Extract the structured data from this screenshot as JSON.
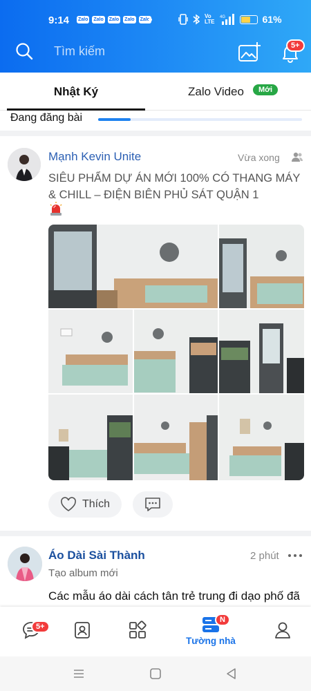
{
  "status_bar": {
    "time": "9:14",
    "notification_apps": [
      "Zalo",
      "Zalo",
      "Zalo",
      "Zalo",
      "Zalo"
    ],
    "network": "4G",
    "volte": "Vo\nLTE",
    "battery_percent": 61,
    "battery_label": "61%"
  },
  "header": {
    "search_placeholder": "Tìm kiếm",
    "notifications_badge": "5+"
  },
  "tabs": {
    "diary": "Nhật Ký",
    "video": "Zalo Video",
    "video_badge": "Mới",
    "active": "diary"
  },
  "posting": {
    "label": "Đang đăng bài",
    "progress": 0.16
  },
  "posts": [
    {
      "author": "Mạnh Kevin Unite",
      "time": "Vừa xong",
      "visibility_icon": "friends-icon",
      "text": "SIÊU PHẨM DỰ ÁN MỚI 100% CÓ THANG MÁY & CHILL – ĐIỆN BIÊN PHỦ SÁT QUẬN 1",
      "emoji_icon": "siren-icon",
      "photo_count": 8,
      "like_label": "Thích"
    },
    {
      "author": "Áo Dài Sài Thành",
      "time": "2 phút",
      "subtitle": "Tạo album mới",
      "text": "Các mẫu áo dài cách tân trẻ trung đi dạo phố đã lên kệ rồi ạ, cùng khám phá nhé"
    }
  ],
  "bottom_nav": {
    "messages_badge": "5+",
    "timeline_label": "Tường nhà",
    "timeline_badge": "N",
    "active": "timeline"
  },
  "colors": {
    "header_gradient_start": "#0b6cf0",
    "header_gradient_end": "#2fa8f7",
    "accent": "#1a73e8",
    "badge_red": "#f23b3b",
    "new_badge_green": "#27a745",
    "author_link": "#2b5fb3"
  }
}
